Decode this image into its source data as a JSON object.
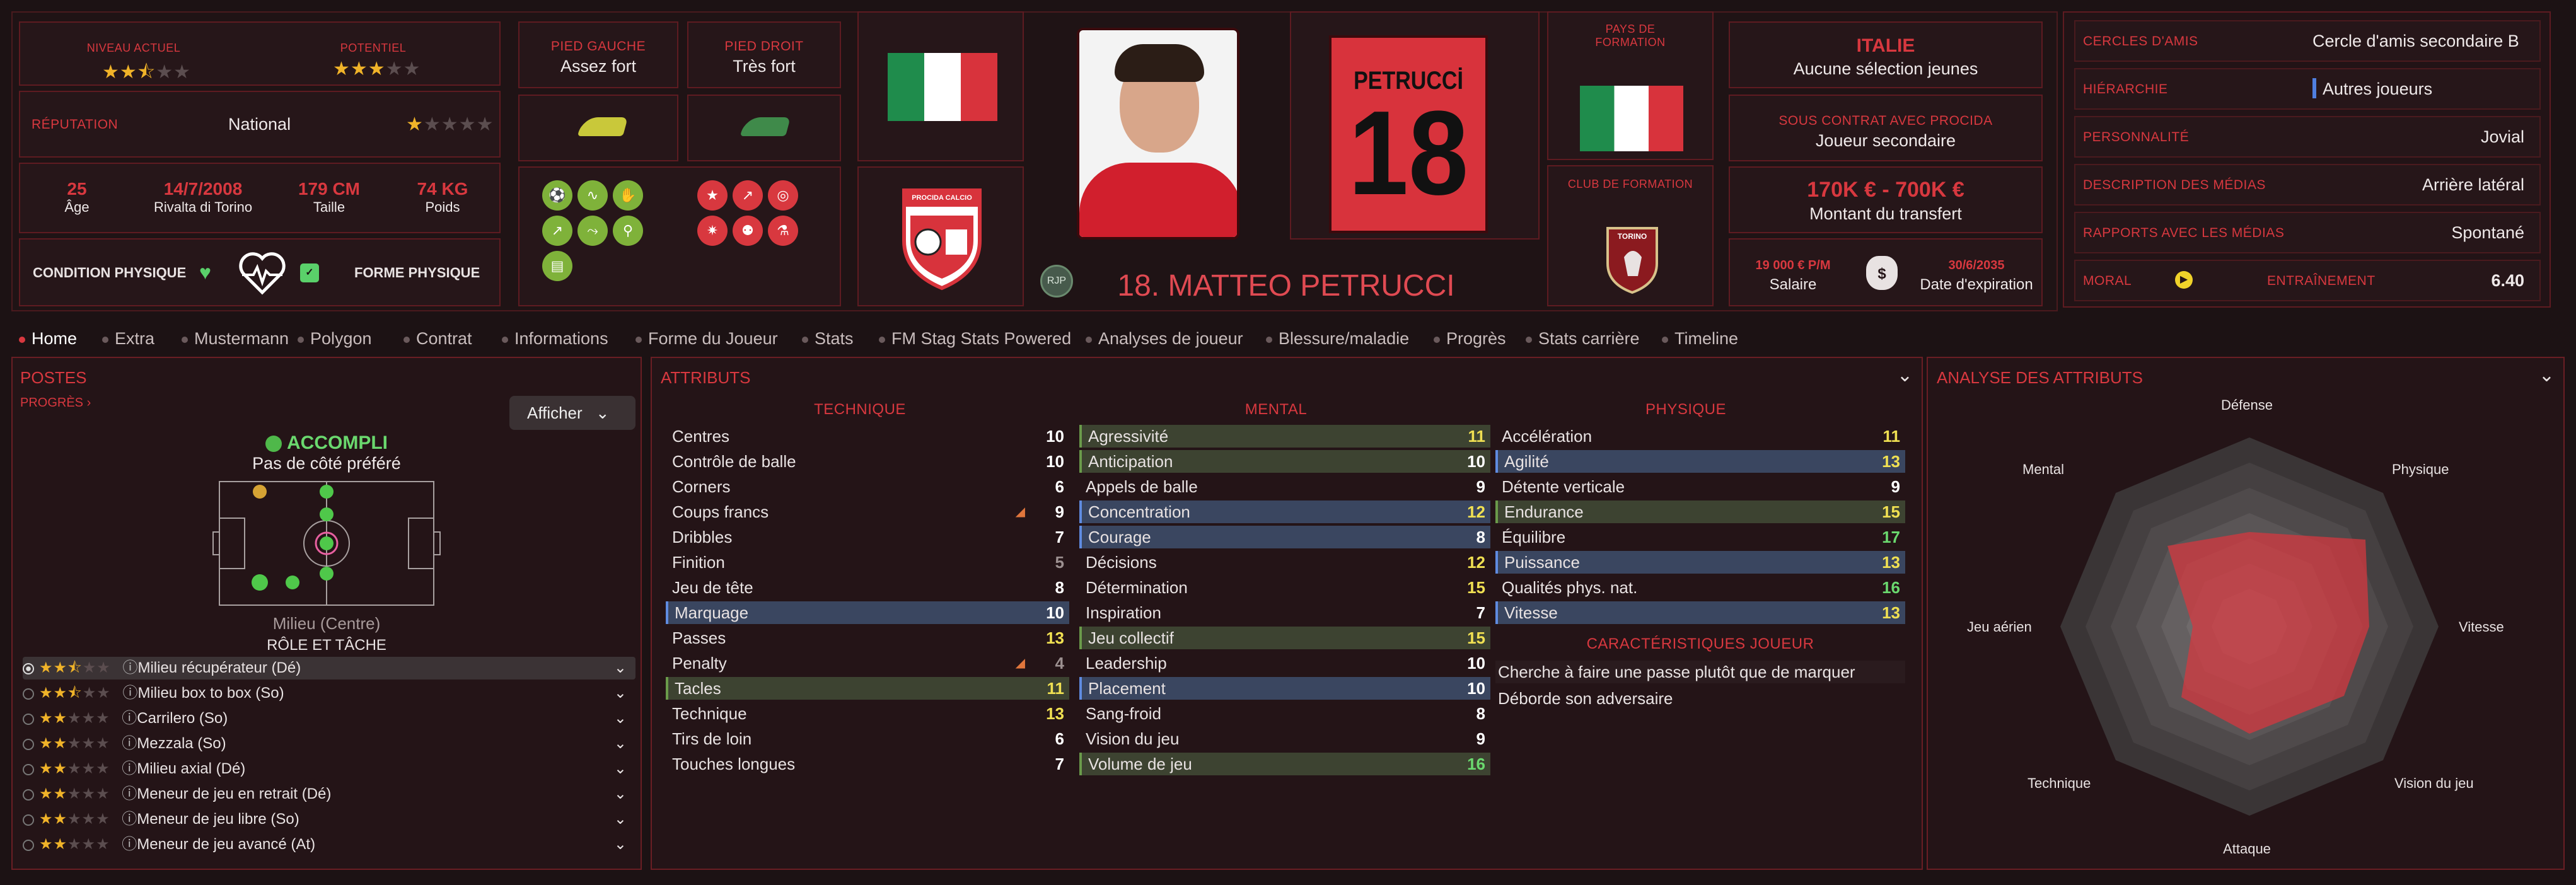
{
  "top": {
    "level_label": "NIVEAU ACTUEL",
    "potential_label": "POTENTIEL",
    "reputation_label": "RÉPUTATION",
    "reputation_value": "National",
    "age_value": "25",
    "age_label": "Âge",
    "birth_value": "14/7/2008",
    "birth_label": "Rivalta di Torino",
    "height_value": "179 CM",
    "height_label": "Taille",
    "weight_value": "74 KG",
    "weight_label": "Poids",
    "condition_label": "CONDITION PHYSIQUE",
    "form_label": "FORME PHYSIQUE",
    "left_foot_label": "PIED GAUCHE",
    "left_foot_value": "Assez fort",
    "right_foot_label": "PIED DROIT",
    "right_foot_value": "Très fort",
    "rjp": "RJP",
    "player_name": "18. MATTEO PETRUCCI",
    "shirt_name": "PETRUCCİ",
    "shirt_number": "18",
    "club_logo_text": "PROCIDA CALCIO",
    "formation_country_label": "PAYS DE FORMATION",
    "formation_club_label": "CLUB DE FORMATION",
    "formation_club_logo_text": "TORINO",
    "nation": "ITALIE",
    "nation_sub": "Aucune sélection jeunes",
    "contract_label": "SOUS CONTRAT AVEC PROCIDA",
    "contract_value": "Joueur secondaire",
    "transfer_value": "170K € - 700K €",
    "transfer_label": "Montant du transfert",
    "salary_value": "19 000 € P/M",
    "salary_label": "Salaire",
    "expiry_value": "30/6/2035",
    "expiry_label": "Date d'expiration",
    "info": [
      {
        "label": "CERCLES D'AMIS",
        "value": "Cercle d'amis secondaire B"
      },
      {
        "label": "HIÉRARCHIE",
        "value": "Autres joueurs"
      },
      {
        "label": "PERSONNALITÉ",
        "value": "Jovial"
      },
      {
        "label": "DESCRIPTION DES MÉDIAS",
        "value": "Arrière latéral"
      },
      {
        "label": "RAPPORTS AVEC LES MÉDIAS",
        "value": "Spontané"
      }
    ],
    "moral_label": "MORAL",
    "training_label": "ENTRAÎNEMENT",
    "training_value": "6.40"
  },
  "tabs": [
    "Home",
    "Extra",
    "Mustermann",
    "Polygon",
    "Contrat",
    "Informations",
    "Forme du Joueur",
    "Stats",
    "FM Stag Stats Powered",
    "Analyses de joueur",
    "Blessure/maladie",
    "Progrès",
    "Stats carrière",
    "Timeline"
  ],
  "postes": {
    "title": "POSTES",
    "progress": "PROGRÈS",
    "show_button": "Afficher",
    "status": "ACCOMPLI",
    "side": "Pas de côté préféré",
    "position": "Milieu (Centre)",
    "role_label": "RÔLE ET TÂCHE",
    "roles": [
      {
        "name": "Milieu récupérateur (Dé)",
        "stars": 2.5
      },
      {
        "name": "Milieu box to box (So)",
        "stars": 2.5
      },
      {
        "name": "Carrilero (So)",
        "stars": 2
      },
      {
        "name": "Mezzala (So)",
        "stars": 2
      },
      {
        "name": "Milieu axial (Dé)",
        "stars": 2
      },
      {
        "name": "Meneur de jeu en retrait (Dé)",
        "stars": 2
      },
      {
        "name": "Meneur de jeu libre (So)",
        "stars": 2
      },
      {
        "name": "Meneur de jeu avancé (At)",
        "stars": 2
      }
    ]
  },
  "attributes": {
    "title": "ATTRIBUTS",
    "technique_label": "TECHNIQUE",
    "mental_label": "MENTAL",
    "physique_label": "PHYSIQUE",
    "technique": [
      {
        "n": "Centres",
        "v": "10"
      },
      {
        "n": "Contrôle de balle",
        "v": "10"
      },
      {
        "n": "Corners",
        "v": "6"
      },
      {
        "n": "Coups francs",
        "v": "9"
      },
      {
        "n": "Dribbles",
        "v": "7"
      },
      {
        "n": "Finition",
        "v": "5"
      },
      {
        "n": "Jeu de tête",
        "v": "8"
      },
      {
        "n": "Marquage",
        "v": "10"
      },
      {
        "n": "Passes",
        "v": "13"
      },
      {
        "n": "Penalty",
        "v": "4"
      },
      {
        "n": "Tacles",
        "v": "11"
      },
      {
        "n": "Technique",
        "v": "13"
      },
      {
        "n": "Tirs de loin",
        "v": "6"
      },
      {
        "n": "Touches longues",
        "v": "7"
      }
    ],
    "mental": [
      {
        "n": "Agressivité",
        "v": "11"
      },
      {
        "n": "Anticipation",
        "v": "10"
      },
      {
        "n": "Appels de balle",
        "v": "9"
      },
      {
        "n": "Concentration",
        "v": "12"
      },
      {
        "n": "Courage",
        "v": "8"
      },
      {
        "n": "Décisions",
        "v": "12"
      },
      {
        "n": "Détermination",
        "v": "15"
      },
      {
        "n": "Inspiration",
        "v": "7"
      },
      {
        "n": "Jeu collectif",
        "v": "15"
      },
      {
        "n": "Leadership",
        "v": "10"
      },
      {
        "n": "Placement",
        "v": "10"
      },
      {
        "n": "Sang-froid",
        "v": "8"
      },
      {
        "n": "Vision du jeu",
        "v": "9"
      },
      {
        "n": "Volume de jeu",
        "v": "16"
      }
    ],
    "physique": [
      {
        "n": "Accélération",
        "v": "11"
      },
      {
        "n": "Agilité",
        "v": "13"
      },
      {
        "n": "Détente verticale",
        "v": "9"
      },
      {
        "n": "Endurance",
        "v": "15"
      },
      {
        "n": "Équilibre",
        "v": "17"
      },
      {
        "n": "Puissance",
        "v": "13"
      },
      {
        "n": "Qualités phys. nat.",
        "v": "16"
      },
      {
        "n": "Vitesse",
        "v": "13"
      }
    ],
    "traits_label": "CARACTÉRISTIQUES JOUEUR",
    "traits": [
      "Cherche à faire une passe plutôt que de marquer",
      "Déborde son adversaire"
    ]
  },
  "analysis": {
    "title": "ANALYSE DES ATTRIBUTS",
    "axes": [
      "Défense",
      "Physique",
      "Vitesse",
      "Vision du jeu",
      "Attaque",
      "Technique",
      "Jeu aérien",
      "Mental"
    ]
  },
  "colors": {
    "accent": "#d8383f",
    "panel": "#241417",
    "border": "#6a1e24"
  }
}
